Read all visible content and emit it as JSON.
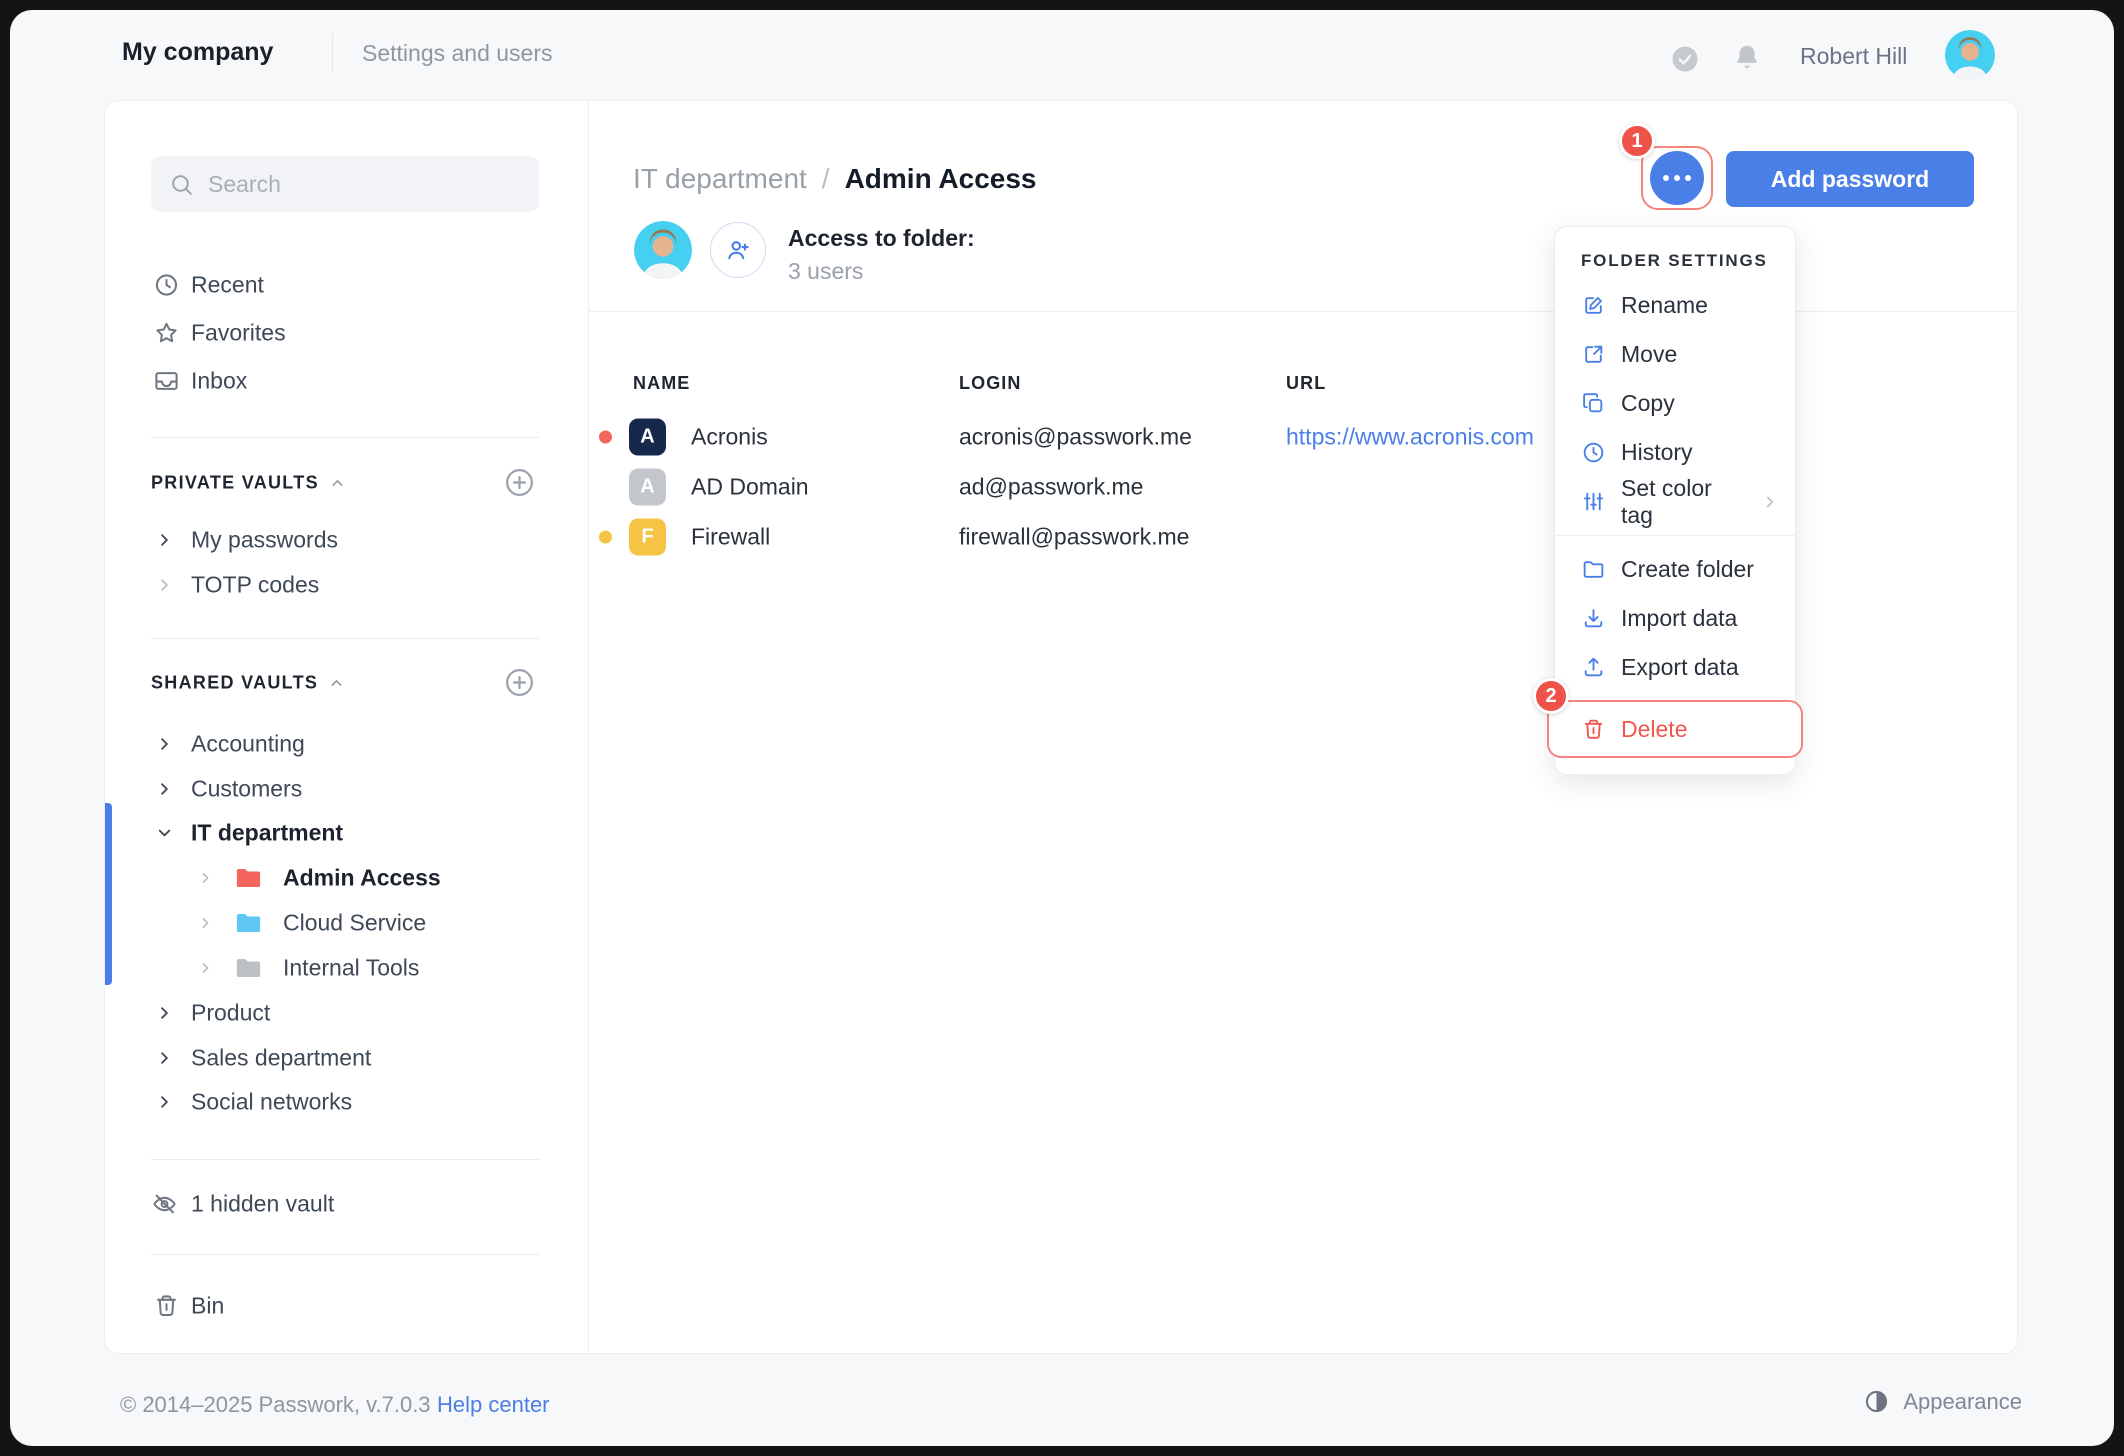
{
  "topbar": {
    "company": "My company",
    "section": "Settings and users",
    "user": "Robert Hill"
  },
  "sidebar": {
    "search_placeholder": "Search",
    "recent": "Recent",
    "favorites": "Favorites",
    "inbox": "Inbox",
    "private_title": "PRIVATE VAULTS",
    "private_items": [
      {
        "label": "My passwords"
      },
      {
        "label": "TOTP codes"
      }
    ],
    "shared_title": "SHARED VAULTS",
    "shared_items": [
      {
        "label": "Accounting"
      },
      {
        "label": "Customers"
      },
      {
        "label": "IT department"
      },
      {
        "label": "Admin Access"
      },
      {
        "label": "Cloud Service"
      },
      {
        "label": "Internal Tools"
      },
      {
        "label": "Product"
      },
      {
        "label": "Sales department"
      },
      {
        "label": "Social networks"
      }
    ],
    "hidden_vault": "1 hidden vault",
    "bin": "Bin"
  },
  "content": {
    "breadcrumb": {
      "parent": "IT department",
      "separator": "/",
      "current": "Admin Access"
    },
    "access_title": "Access to folder:",
    "access_count": "3 users",
    "add_password": "Add password",
    "step_badges": {
      "more": "1",
      "delete": "2"
    },
    "table": {
      "headers": {
        "name": "NAME",
        "login": "LOGIN",
        "url": "URL"
      },
      "rows": [
        {
          "name": "Acronis",
          "login": "acronis@passwork.me",
          "url": "https://www.acronis.com",
          "icon_letter": "A",
          "tag_color": "#f4655e",
          "icon_bg": "#16294d"
        },
        {
          "name": "AD Domain",
          "login": "ad@passwork.me",
          "url": "",
          "icon_letter": "A",
          "tag_color": "",
          "icon_bg": "#c3c7cc"
        },
        {
          "name": "Firewall",
          "login": "firewall@passwork.me",
          "url": "",
          "icon_letter": "F",
          "tag_color": "#f6c444",
          "icon_bg": "#f6c444"
        }
      ]
    },
    "menu": {
      "title": "FOLDER SETTINGS",
      "items": [
        {
          "label": "Rename"
        },
        {
          "label": "Move"
        },
        {
          "label": "Copy"
        },
        {
          "label": "History"
        },
        {
          "label": "Set color tag"
        },
        {
          "label": "Create folder"
        },
        {
          "label": "Import data"
        },
        {
          "label": "Export data"
        },
        {
          "label": "Delete"
        }
      ]
    }
  },
  "footer": {
    "copyright": "© 2014–2025 Passwork, v.7.0.3",
    "help": "Help center",
    "appearance": "Appearance"
  },
  "colors": {
    "accent_blue": "#4a7fe8",
    "alert_red": "#ee5349",
    "highlight_red": "#f3857e",
    "tag_red": "#f4655e",
    "tag_yellow": "#f6c444",
    "folder_red": "#f4655e",
    "folder_blue": "#5ec8f2",
    "folder_gray": "#bcc0c5",
    "icon_navy": "#16294d"
  }
}
